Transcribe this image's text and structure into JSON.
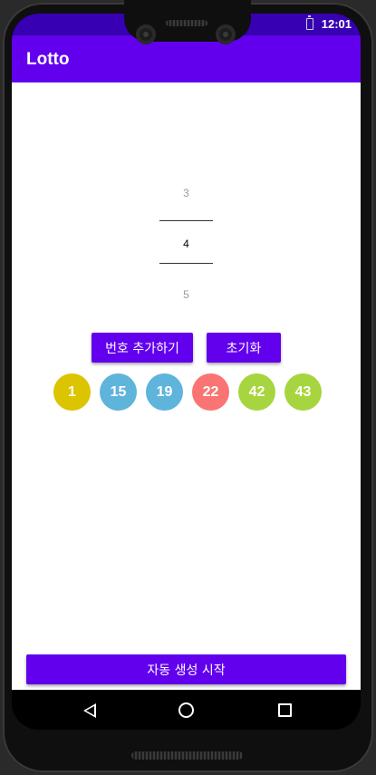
{
  "status_bar": {
    "time": "12:01"
  },
  "app_bar": {
    "title": "Lotto"
  },
  "picker": {
    "above": "3",
    "selected": "4",
    "below": "5"
  },
  "actions": {
    "add_label": "번호 추가하기",
    "reset_label": "초기화"
  },
  "numbers": [
    {
      "value": "1",
      "color": "#dbc400"
    },
    {
      "value": "15",
      "color": "#5fb4dc"
    },
    {
      "value": "19",
      "color": "#5fb4dc"
    },
    {
      "value": "22",
      "color": "#fa7474"
    },
    {
      "value": "42",
      "color": "#a7d53f"
    },
    {
      "value": "43",
      "color": "#a7d53f"
    }
  ],
  "auto_generate": {
    "label": "자동 생성 시작"
  },
  "nav": {
    "back": "back-icon",
    "home": "home-icon",
    "recents": "recents-icon"
  },
  "colors": {
    "primary": "#6200ee",
    "primary_dark": "#3700b3"
  }
}
